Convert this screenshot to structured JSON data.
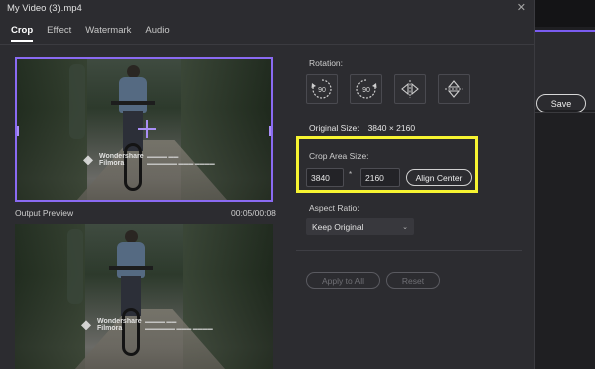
{
  "window": {
    "title": "My Video (3).mp4"
  },
  "tabs": [
    {
      "label": "Crop"
    },
    {
      "label": "Effect"
    },
    {
      "label": "Watermark"
    },
    {
      "label": "Audio"
    }
  ],
  "preview": {
    "watermark_name_line1": "Wondershare",
    "watermark_name_line2": "Filmora",
    "output_label": "Output Preview",
    "time": "00:05/00:08"
  },
  "rotation": {
    "label": "Rotation:",
    "buttons": [
      "90",
      "90"
    ]
  },
  "original_size": {
    "label": "Original Size:",
    "value": "3840 × 2160"
  },
  "crop": {
    "label": "Crop Area Size:",
    "width": "3840",
    "separator": "*",
    "height": "2160",
    "align_center": "Align Center"
  },
  "aspect": {
    "label": "Aspect Ratio:",
    "value": "Keep Original"
  },
  "actions": {
    "apply_all": "Apply to All",
    "reset": "Reset"
  },
  "background": {
    "save": "Save"
  },
  "colors": {
    "accent": "#8a6af2",
    "highlight": "#f7f431"
  },
  "icons": [
    "close-icon",
    "rotate-cw-icon",
    "rotate-ccw-icon",
    "flip-horizontal-icon",
    "flip-vertical-icon",
    "move-icon",
    "chevron-down-icon"
  ]
}
